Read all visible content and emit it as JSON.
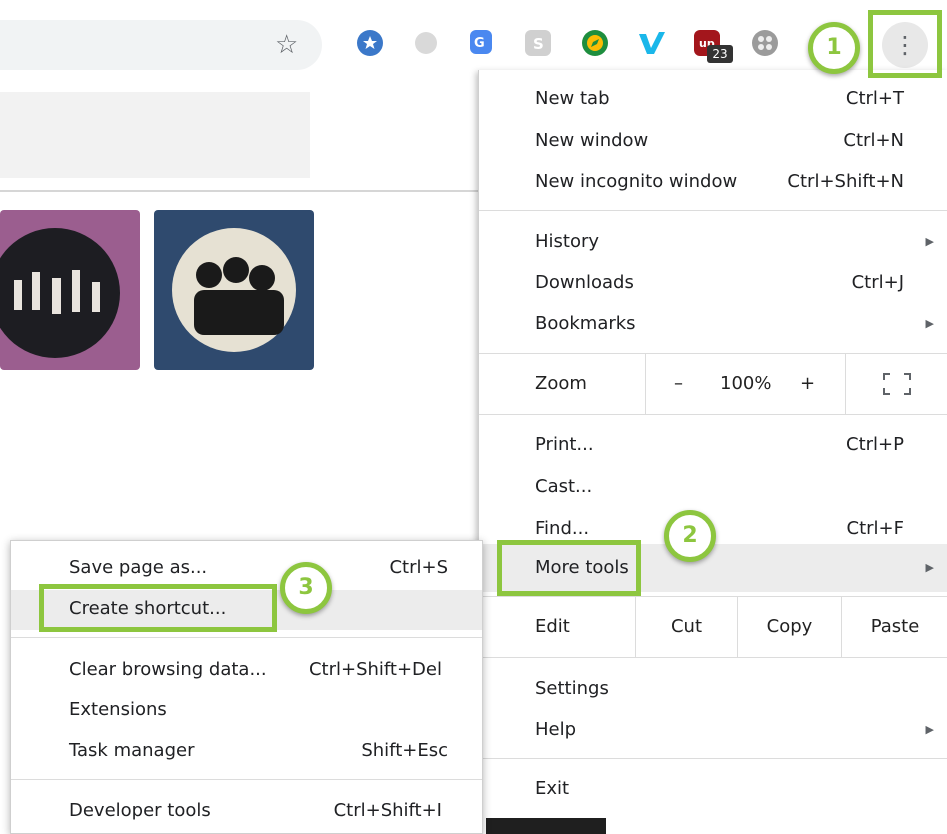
{
  "toolbar": {
    "kebab_glyph": "⋮",
    "extensions": [
      {
        "name": "circle-star-extension",
        "color": "#3b78c9"
      },
      {
        "name": "grey-circle-extension",
        "color": "#bcbcbc"
      },
      {
        "name": "google-translate-extension",
        "color": "#4a88f0"
      },
      {
        "name": "skype-extension",
        "color": "#9aa0a6"
      },
      {
        "name": "compass-extension",
        "color": "#1e8e3e"
      },
      {
        "name": "vimeo-extension",
        "color": "#1ab7ea"
      },
      {
        "name": "ublock-extension",
        "color": "#a3161c"
      },
      {
        "name": "reel-extension",
        "color": "#8a8a8a"
      }
    ],
    "ublock_badge": "23"
  },
  "menu": {
    "new_tab": {
      "label": "New tab",
      "shortcut": "Ctrl+T"
    },
    "new_window": {
      "label": "New window",
      "shortcut": "Ctrl+N"
    },
    "new_incognito": {
      "label": "New incognito window",
      "shortcut": "Ctrl+Shift+N"
    },
    "history": {
      "label": "History"
    },
    "downloads": {
      "label": "Downloads",
      "shortcut": "Ctrl+J"
    },
    "bookmarks": {
      "label": "Bookmarks"
    },
    "zoom": {
      "label": "Zoom",
      "minus": "–",
      "value": "100%",
      "plus": "+"
    },
    "print": {
      "label": "Print...",
      "shortcut": "Ctrl+P"
    },
    "cast": {
      "label": "Cast..."
    },
    "find": {
      "label": "Find...",
      "shortcut": "Ctrl+F"
    },
    "more_tools": {
      "label": "More tools"
    },
    "edit": {
      "label": "Edit",
      "cut": "Cut",
      "copy": "Copy",
      "paste": "Paste"
    },
    "settings": {
      "label": "Settings"
    },
    "help": {
      "label": "Help"
    },
    "exit": {
      "label": "Exit"
    }
  },
  "submenu": {
    "save_page": {
      "label": "Save page as...",
      "shortcut": "Ctrl+S"
    },
    "create_shortcut": {
      "label": "Create shortcut..."
    },
    "clear_browsing": {
      "label": "Clear browsing data...",
      "shortcut": "Ctrl+Shift+Del"
    },
    "extensions": {
      "label": "Extensions"
    },
    "task_manager": {
      "label": "Task manager",
      "shortcut": "Shift+Esc"
    },
    "developer_tools": {
      "label": "Developer tools",
      "shortcut": "Ctrl+Shift+I"
    }
  },
  "callouts": {
    "one": "1",
    "two": "2",
    "three": "3"
  },
  "colors": {
    "accent_green": "#8dc63f",
    "menu_highlight": "#ececec"
  }
}
